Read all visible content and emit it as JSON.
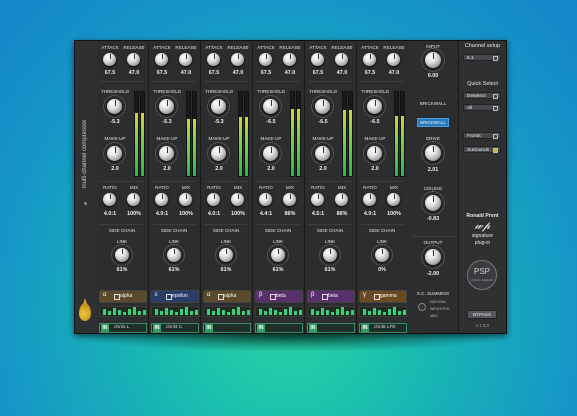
{
  "plugin_name": "multi-channel compressor",
  "channels": [
    {
      "attack": "67.5",
      "release": "47.0",
      "threshold": "-5.3",
      "makeup": "2.0",
      "ratio": "4.0:1",
      "mix": "100%",
      "link": "61%",
      "sc_greek": "α",
      "sc_name": "alpha",
      "sc_color": "#5b4a2c",
      "channel": "chnl1 L",
      "meter": 0.75
    },
    {
      "attack": "67.5",
      "release": "47.0",
      "threshold": "-5.3",
      "makeup": "2.0",
      "ratio": "4.0:1",
      "mix": "100%",
      "link": "61%",
      "sc_greek": "ε",
      "sc_name": "epsilon",
      "sc_color": "#2a3c6a",
      "channel": "chnl3 C",
      "meter": 0.68
    },
    {
      "attack": "67.5",
      "release": "47.0",
      "threshold": "-5.3",
      "makeup": "2.0",
      "ratio": "4.0:1",
      "mix": "100%",
      "link": "61%",
      "sc_greek": "α",
      "sc_name": "alpha",
      "sc_color": "#5b4a2c",
      "channel": "",
      "meter": 0.7
    },
    {
      "attack": "67.5",
      "release": "47.0",
      "threshold": "-6.5",
      "makeup": "2.0",
      "ratio": "4.4:1",
      "mix": "86%",
      "link": "61%",
      "sc_greek": "β",
      "sc_name": "beta",
      "sc_color": "#5a2f6e",
      "channel": "",
      "meter": 0.8
    },
    {
      "attack": "67.5",
      "release": "47.0",
      "threshold": "-6.5",
      "makeup": "2.0",
      "ratio": "4.5:1",
      "mix": "86%",
      "link": "61%",
      "sc_greek": "β",
      "sc_name": "beta",
      "sc_color": "#5a2f6e",
      "channel": "",
      "meter": 0.78
    },
    {
      "attack": "67.5",
      "release": "47.0",
      "threshold": "-6.5",
      "makeup": "2.0",
      "ratio": "4.0:1",
      "mix": "100%",
      "link": "0%",
      "sc_greek": "γ",
      "sc_name": "gamma",
      "sc_color": "#6b4a22",
      "channel": "chnl6 LFE",
      "meter": 0.72
    }
  ],
  "labels": {
    "attack": "ATTACK",
    "release": "RELEASE",
    "threshold": "THRESHOLD",
    "makeup": "MAKE-UP",
    "ratio": "RATIO",
    "mix": "MIX",
    "sidechain": "SIDE CHAIN",
    "link": "LINK",
    "in": "IN"
  },
  "master": {
    "input_label": "INPUT",
    "input_value": "0.00",
    "brickwall_label": "BRICKWALL",
    "brickwall_button": "BRICKWALL",
    "drive_label": "DRIVE",
    "drive_value": "2.01",
    "ceiling_label": "CEILING",
    "ceiling_value": "-0.83",
    "output_label": "OUTPUT",
    "output_value": "-2.00",
    "sc_summing": "S.C. SUMMING",
    "summing_options": [
      "NATURAL",
      "WEIGHTED",
      "MAX"
    ]
  },
  "right_panel": {
    "channel_setup_title": "Channel setup",
    "channel_setup_value": "6.1",
    "quick_select_title": "Quick Select",
    "quick_buttons": [
      "Deselect",
      "All"
    ],
    "group_buttons": [
      "Fronts",
      "Surrounds"
    ],
    "signature_name": "Ronald Prent",
    "signature_sub1": "signature",
    "signature_sub2": "plug-in",
    "badge_main": "PSP",
    "badge_sub": "AURAL SERIES",
    "bypass": "BYPASS",
    "version": "v 1.0.0"
  }
}
